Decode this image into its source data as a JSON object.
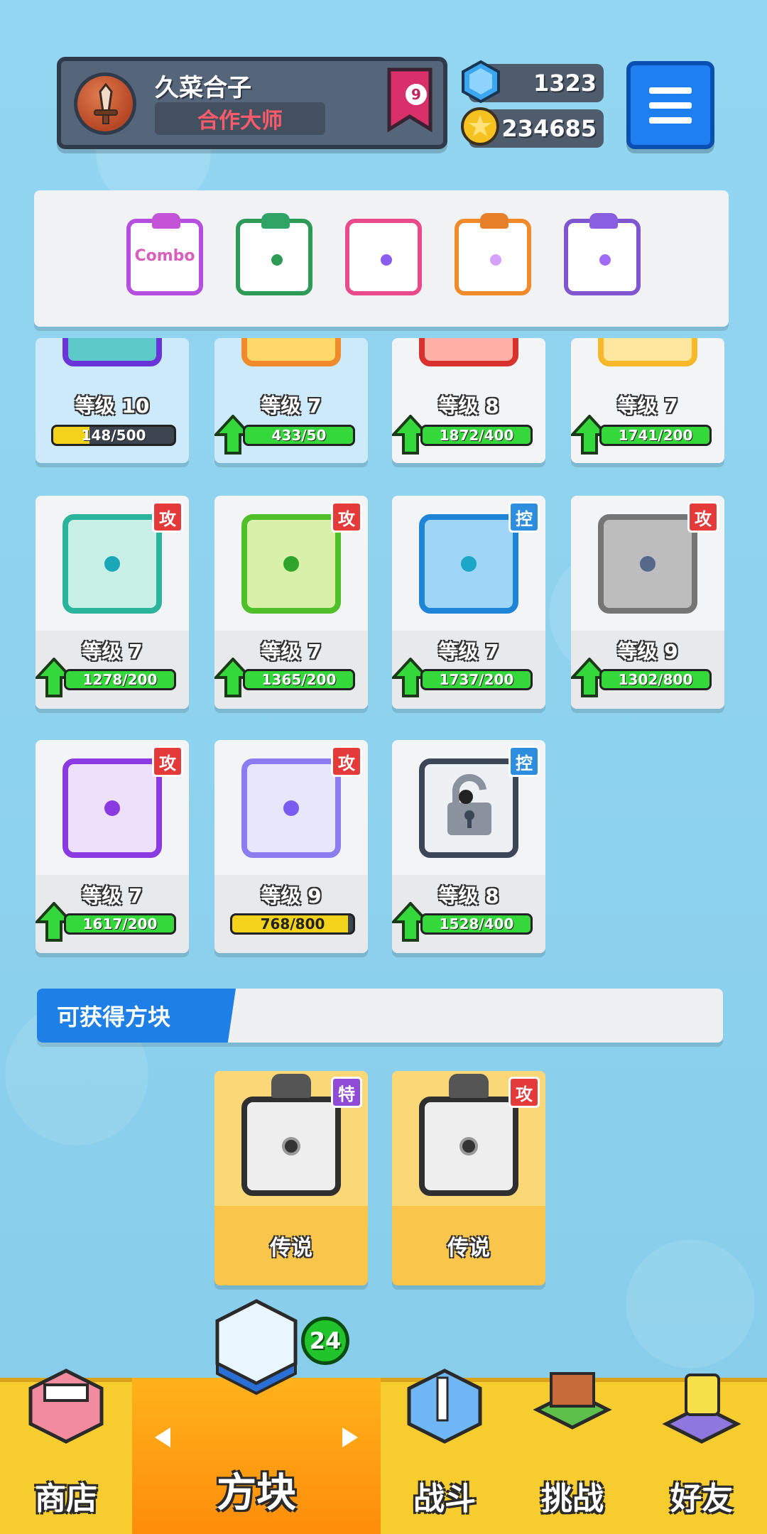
{
  "player": {
    "name": "久菜合子",
    "title": "合作大师",
    "rank": "9"
  },
  "currency": {
    "gems": "1323",
    "coins": "234685"
  },
  "icons": {
    "gem": "diamond-icon",
    "coin": "star-coin-icon",
    "menu": "hamburger-menu-icon",
    "upgrade": "green-up-arrow-icon",
    "lock": "lock-icon"
  },
  "deck": [
    {
      "name": "combo",
      "label": "Combo"
    },
    {
      "name": "wind"
    },
    {
      "name": "rainbow"
    },
    {
      "name": "infinity"
    },
    {
      "name": "spiral"
    }
  ],
  "dice_cards": [
    {
      "level": "等级 10",
      "progress": "148/500",
      "fill": 0.3,
      "bar_color": "#f2d21b",
      "upgrade": false
    },
    {
      "level": "等级 7",
      "progress": "433/50",
      "fill": 1.0,
      "bar_color": "#35d83a",
      "upgrade": true
    },
    {
      "level": "等级 8",
      "progress": "1872/400",
      "fill": 1.0,
      "bar_color": "#35d83a",
      "upgrade": true
    },
    {
      "level": "等级 7",
      "progress": "1741/200",
      "fill": 1.0,
      "bar_color": "#35d83a",
      "upgrade": true
    },
    {
      "level": "等级 7",
      "progress": "1278/200",
      "fill": 1.0,
      "bar_color": "#35d83a",
      "upgrade": true,
      "tag": "攻"
    },
    {
      "level": "等级 7",
      "progress": "1365/200",
      "fill": 1.0,
      "bar_color": "#35d83a",
      "upgrade": true,
      "tag": "攻"
    },
    {
      "level": "等级 7",
      "progress": "1737/200",
      "fill": 1.0,
      "bar_color": "#35d83a",
      "upgrade": true,
      "tag": "控"
    },
    {
      "level": "等级 9",
      "progress": "1302/800",
      "fill": 1.0,
      "bar_color": "#35d83a",
      "upgrade": true,
      "tag": "攻"
    },
    {
      "level": "等级 7",
      "progress": "1617/200",
      "fill": 1.0,
      "bar_color": "#35d83a",
      "upgrade": true,
      "tag": "攻"
    },
    {
      "level": "等级 9",
      "progress": "768/800",
      "fill": 0.96,
      "bar_color": "#f2d21b",
      "upgrade": false,
      "tag": "攻"
    },
    {
      "level": "等级 8",
      "progress": "1528/400",
      "fill": 1.0,
      "bar_color": "#35d83a",
      "upgrade": true,
      "tag": "控"
    }
  ],
  "available": {
    "title": "可获得方块",
    "items": [
      {
        "rarity": "传说",
        "tag": "特"
      },
      {
        "rarity": "传说",
        "tag": "攻"
      }
    ]
  },
  "nav": {
    "shop": "商店",
    "dice": "方块",
    "battle": "战斗",
    "challenge": "挑战",
    "friends": "好友",
    "dice_badge": "24"
  }
}
